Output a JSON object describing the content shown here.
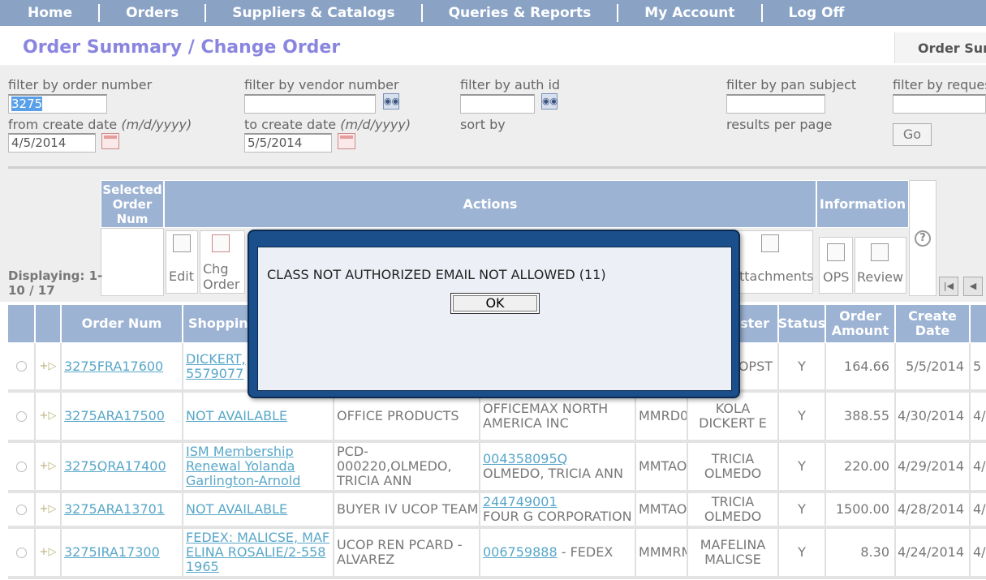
{
  "nav": [
    "Home",
    "Orders",
    "Suppliers & Catalogs",
    "Queries & Reports",
    "My Account",
    "Log Off"
  ],
  "page_title": "Order Summary / Change Order",
  "summary_tab": "Order Sum",
  "filters": {
    "order_number_label": "filter by order number",
    "order_number_value": "3275",
    "vendor_number_label": "filter by vendor number",
    "auth_id_label": "filter by auth id",
    "pan_subject_label": "filter by pan subject",
    "requester_label": "filter by reques",
    "from_date_label": "from create date",
    "to_date_label": "to create date",
    "date_format": "(m/d/yyyy)",
    "from_date_value": "4/5/2014",
    "to_date_value": "5/5/2014",
    "sort_by_label": "sort by",
    "results_per_page_label": "results per page",
    "go_label": "Go"
  },
  "actions_panel": {
    "selected_header": "Selected Order Num",
    "actions_header": "Actions",
    "information_header": "Information",
    "edit_label": "Edit",
    "chg_order_label": "Chg Order",
    "attachments_label": "ttachments",
    "ops_label": "OPS",
    "review_label": "Review",
    "help_glyph": "?",
    "displaying": "Displaying: 1-10 / 17"
  },
  "table": {
    "headers": {
      "order_num": "Order Num",
      "shopping": "Shoppin",
      "requester": "ester",
      "status": "Status",
      "order_amount": "Order Amount",
      "create_date": "Create Date"
    },
    "rows": [
      {
        "order_num": "3275FRA17600",
        "shopping": "DICKERT,",
        "shopping2": "5579077",
        "requester": "OPST",
        "status": "Y",
        "amount": "164.66",
        "date": "5/5/2014",
        "extra": "5"
      },
      {
        "order_num": "3275ARA17500",
        "shopping": "NOT AVAILABLE",
        "buyer": "OFFICE PRODUCTS",
        "supplier_name": "OFFICEMAX NORTH AMERICA INC",
        "code": "MMRD0",
        "requester": "KOLA DICKERT E",
        "status": "Y",
        "amount": "388.55",
        "date": "4/30/2014",
        "extra": "4/"
      },
      {
        "order_num": "3275QRA17400",
        "shopping": "ISM Membership Renewal Yolanda Garlington-Arnold",
        "buyer": "PCD-000220,OLMEDO, TRICIA ANN",
        "supplier_num": "004358095Q",
        "supplier_name": "OLMEDO, TRICIA ANN",
        "code": "MMTAO",
        "requester": "TRICIA OLMEDO",
        "status": "Y",
        "amount": "220.00",
        "date": "4/29/2014",
        "extra": "4/"
      },
      {
        "order_num": "3275ARA13701",
        "shopping": "NOT AVAILABLE",
        "buyer": "BUYER IV UCOP TEAM",
        "supplier_num": "244749001",
        "supplier_name": "FOUR G CORPORATION",
        "code": "MMTAO",
        "requester": "TRICIA OLMEDO",
        "status": "Y",
        "amount": "1500.00",
        "date": "4/28/2014",
        "extra": "4/"
      },
      {
        "order_num": "3275IRA17300",
        "shopping": "FEDEX: MALICSE, MAFELINA ROSALIE/2-5581965",
        "buyer": "UCOP REN PCARD - ALVAREZ",
        "supplier_num": "006759888",
        "supplier_name": "FEDEX",
        "code": "MMMRM",
        "requester": "MAFELINA MALICSE",
        "status": "Y",
        "amount": "8.30",
        "date": "4/24/2014",
        "extra": "4/"
      }
    ]
  },
  "dialog": {
    "message": "CLASS NOT AUTHORIZED EMAIL NOT ALLOWED (11)",
    "ok_label": "OK"
  }
}
